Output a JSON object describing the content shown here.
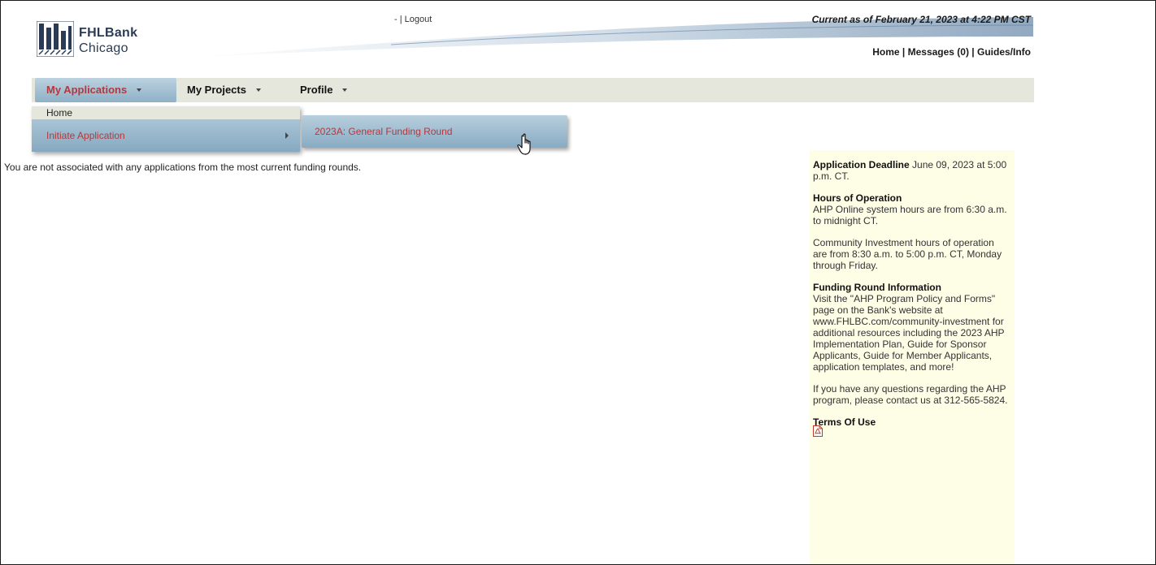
{
  "header": {
    "logo_name": "FHLBank",
    "logo_city": "Chicago",
    "logout_prefix": "- |",
    "logout_label": "Logout",
    "current_as_of": "Current as of February 21, 2023 at 4:22 PM CST",
    "links": {
      "home": "Home",
      "sep1": " | ",
      "messages": "Messages (0)",
      "sep2": " | ",
      "guides": "Guides/Info"
    }
  },
  "menu": {
    "items": [
      {
        "label": "My Applications"
      },
      {
        "label": "My Projects"
      },
      {
        "label": "Profile"
      }
    ],
    "dropdown": {
      "home": "Home",
      "initiate": "Initiate Application"
    },
    "submenu": {
      "item": "2023A: General Funding Round"
    }
  },
  "main": {
    "message": "You are not associated with any applications from the most current funding rounds."
  },
  "sidebar": {
    "deadline_title": "Application Deadline",
    "deadline_text": " June 09, 2023 at 5:00 p.m. CT.",
    "hours_title": "Hours of Operation",
    "hours_text": "AHP Online system hours are from 6:30 a.m. to midnight CT.",
    "ci_hours_text": "Community Investment hours of operation are from 8:30 a.m. to 5:00 p.m. CT, Monday through Friday.",
    "funding_title": "Funding Round Information",
    "funding_text": "Visit the \"AHP Program Policy and Forms\" page on the Bank's website at www.FHLBC.com/community-investment for additional resources including the 2023 AHP Implementation Plan, Guide for Sponsor Applicants, Guide for Member Applicants, application templates, and more!",
    "questions_text": "If you have any questions regarding the AHP program, please contact us at 312-565-5824.",
    "terms_title": "Terms Of Use"
  },
  "colors": {
    "accent_red": "#b0393f",
    "menu_bg": "#e6e7dc",
    "panel_bg": "#fefde6",
    "menu_blue": "#8eb0c6"
  }
}
